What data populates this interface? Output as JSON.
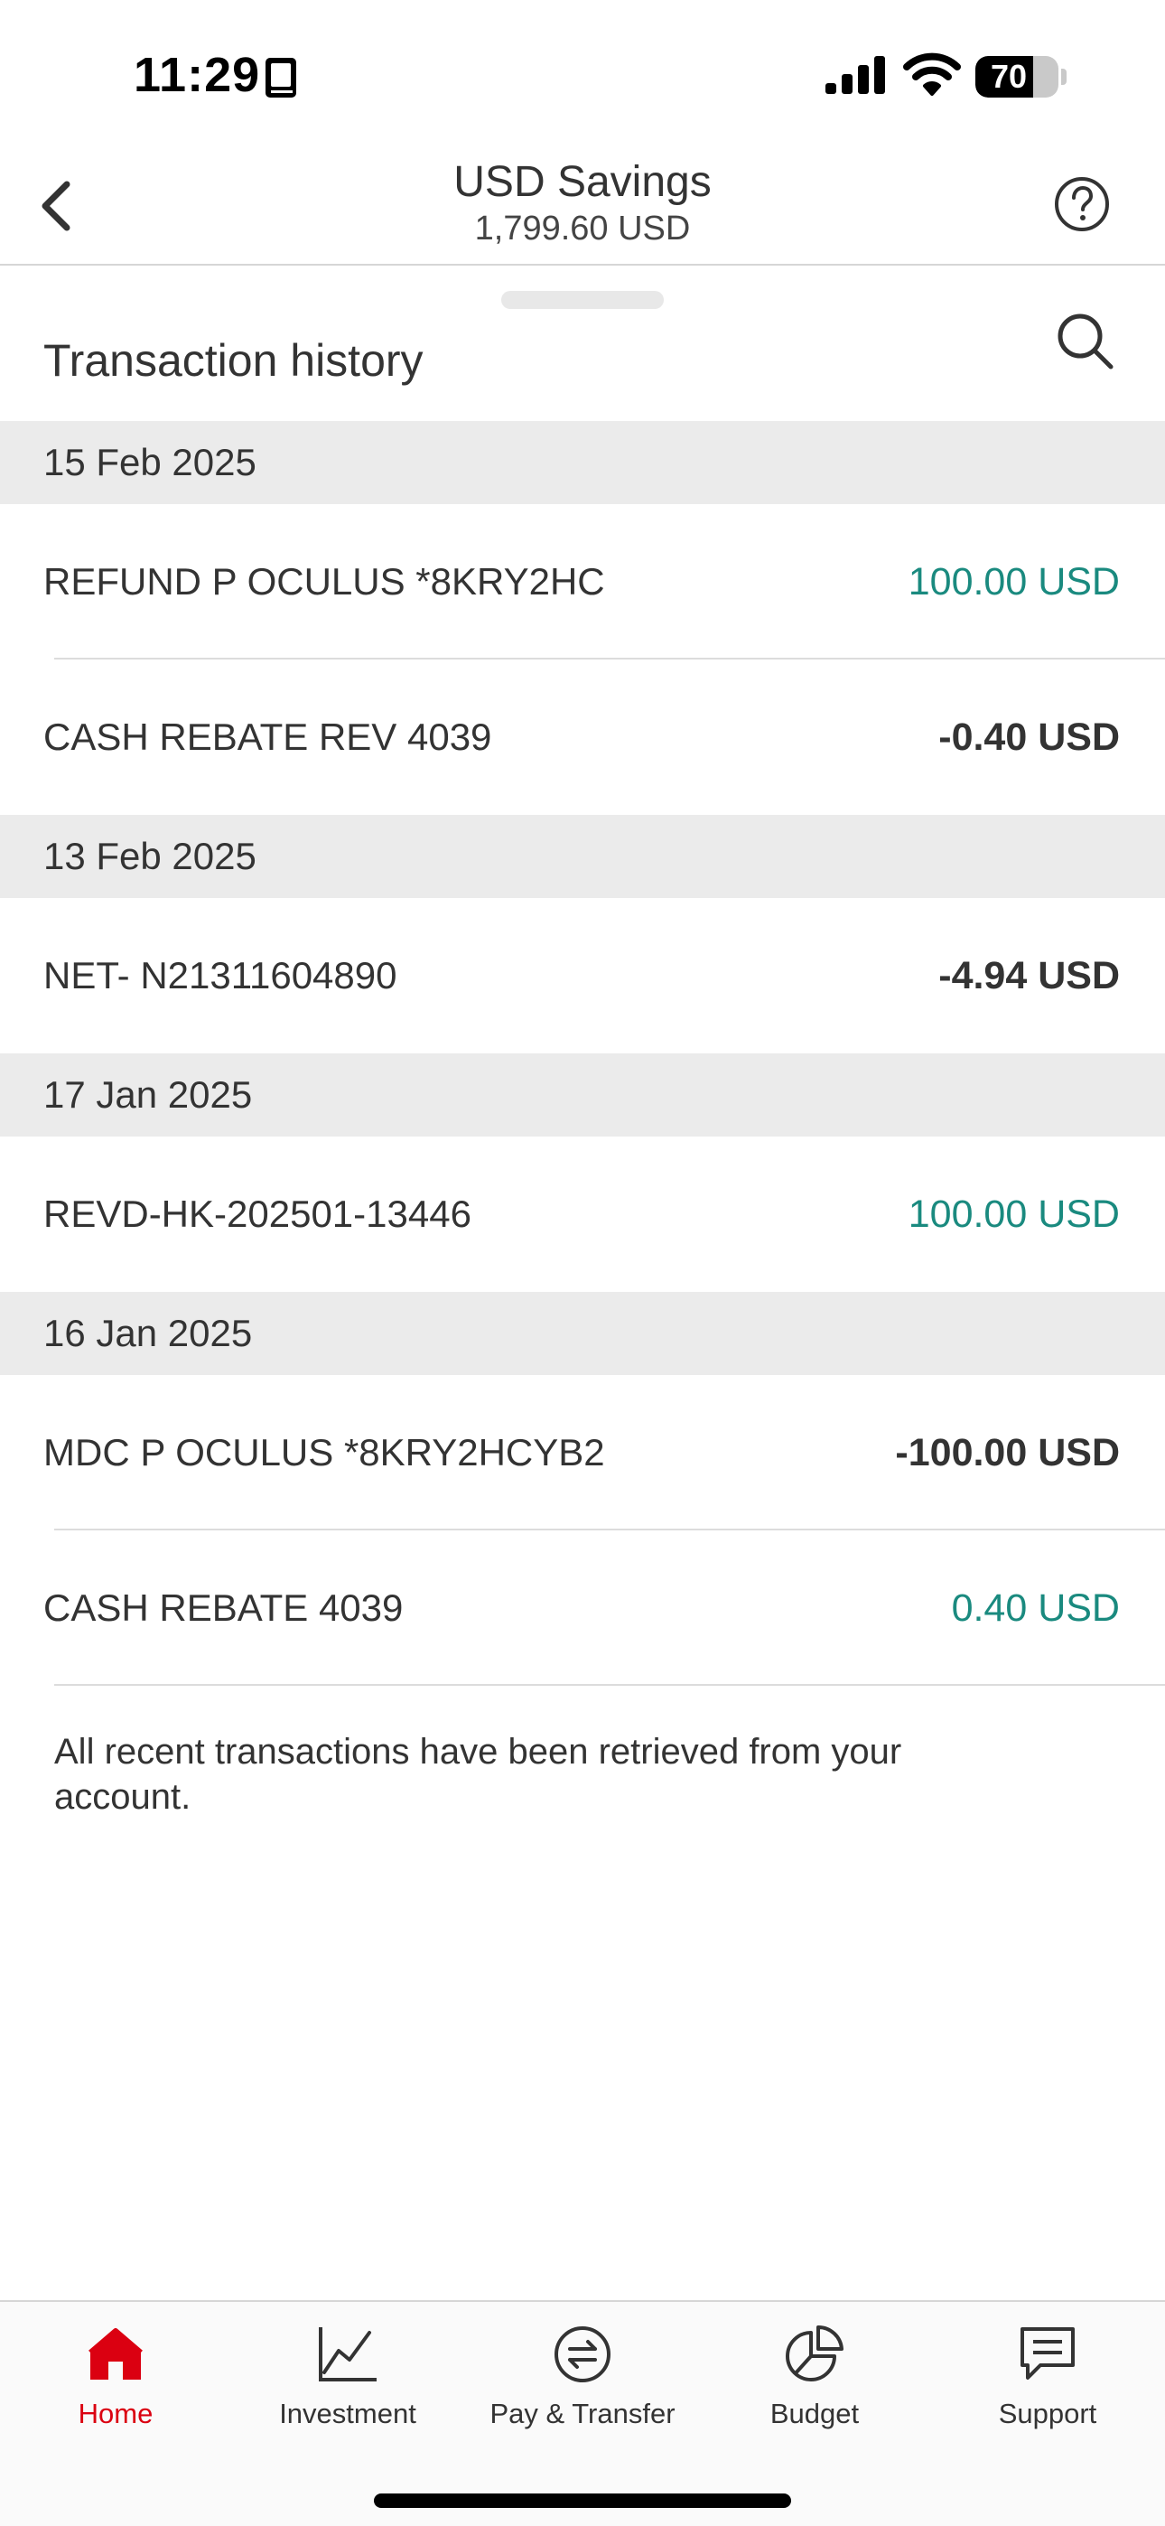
{
  "status_bar": {
    "time": "11:29",
    "battery": "70",
    "battery_level": 0.7,
    "icons": [
      "book-icon",
      "cellular-signal-icon",
      "wifi-icon",
      "battery-icon"
    ]
  },
  "header": {
    "title": "USD Savings",
    "balance": "1,799.60 USD",
    "back_icon": "chevron-left-icon",
    "help_icon": "question-circle-icon"
  },
  "section": {
    "title": "Transaction history",
    "search_icon": "search-icon"
  },
  "groups": [
    {
      "date": "15 Feb 2025",
      "transactions": [
        {
          "description": "REFUND P OCULUS *8KRY2HC",
          "amount": "100.00 USD",
          "type": "credit"
        },
        {
          "description": "CASH REBATE REV 4039",
          "amount": "-0.40 USD",
          "type": "debit"
        }
      ]
    },
    {
      "date": "13 Feb 2025",
      "transactions": [
        {
          "description": "NET- N21311604890",
          "amount": "-4.94 USD",
          "type": "debit"
        }
      ]
    },
    {
      "date": "17 Jan 2025",
      "transactions": [
        {
          "description": "REVD-HK-202501-13446",
          "amount": "100.00 USD",
          "type": "credit"
        }
      ]
    },
    {
      "date": "16 Jan 2025",
      "transactions": [
        {
          "description": "MDC P OCULUS *8KRY2HCYB2",
          "amount": "-100.00 USD",
          "type": "debit"
        },
        {
          "description": "CASH REBATE 4039",
          "amount": "0.40 USD",
          "type": "credit"
        }
      ]
    }
  ],
  "footer_note": "All recent transactions have been retrieved from your account.",
  "tab_bar": {
    "tabs": [
      {
        "label": "Home",
        "icon": "home-icon",
        "active": true
      },
      {
        "label": "Investment",
        "icon": "line-chart-icon",
        "active": false
      },
      {
        "label": "Pay & Transfer",
        "icon": "transfer-arrows-icon",
        "active": false
      },
      {
        "label": "Budget",
        "icon": "pie-chart-icon",
        "active": false
      },
      {
        "label": "Support",
        "icon": "chat-bubble-icon",
        "active": false
      }
    ]
  },
  "colors": {
    "credit": "#1a8a7f",
    "debit": "#333333",
    "accent": "#db0011",
    "date_header_bg": "#ebebeb"
  }
}
